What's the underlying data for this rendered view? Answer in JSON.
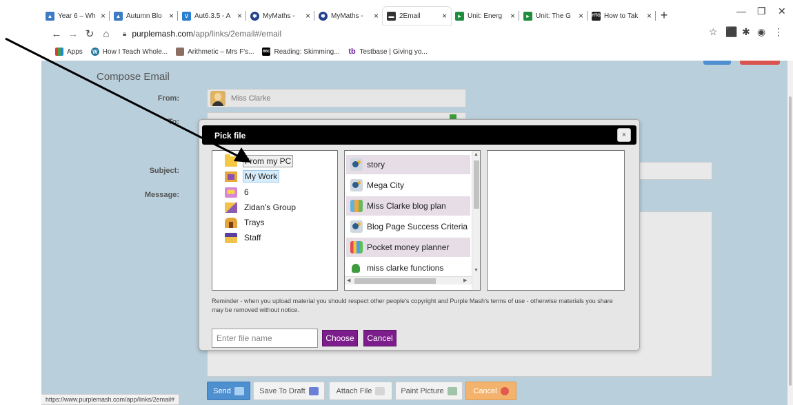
{
  "browser": {
    "tabs": [
      {
        "title": "Year 6 – Wh",
        "icon": "graduation-icon",
        "color": "#3b7cc4",
        "active": false
      },
      {
        "title": "Autumn Blo",
        "icon": "graduation-icon",
        "color": "#3b7cc4",
        "active": false
      },
      {
        "title": "Aut6.3.5 - A",
        "icon": "v-logo-icon",
        "color": "#2a7fd0",
        "active": false
      },
      {
        "title": "MyMaths -",
        "icon": "mymaths-icon",
        "color": "#1f3f8a",
        "active": false
      },
      {
        "title": "MyMaths -",
        "icon": "mymaths-icon",
        "color": "#1f3f8a",
        "active": false
      },
      {
        "title": "2Email",
        "icon": "email-icon",
        "color": "#333333",
        "active": true
      },
      {
        "title": "Unit: Energ",
        "icon": "unit-icon",
        "color": "#1e8e3e",
        "active": false
      },
      {
        "title": "Unit: The G",
        "icon": "unit-icon",
        "color": "#1e8e3e",
        "active": false
      },
      {
        "title": "How to Tak",
        "icon": "htg-icon",
        "color": "#222222",
        "active": false
      }
    ],
    "new_tab": "+",
    "url_host": "purplemash.com",
    "url_path": "/app/links/2email#/email",
    "bookmarks": [
      {
        "label": "Apps",
        "icon": "apps-grid-icon"
      },
      {
        "label": "How I Teach Whole...",
        "icon": "wordpress-icon"
      },
      {
        "label": "Arithmetic – Mrs F's...",
        "icon": "image-icon"
      },
      {
        "label": "Reading: Skimming...",
        "icon": "bbc-icon"
      },
      {
        "label": "Testbase | Giving yo...",
        "icon": "tb-icon"
      }
    ],
    "status_url": "https://www.purplemash.com/app/links/2email#"
  },
  "compose": {
    "title": "Compose Email",
    "from_label": "From:",
    "from_value": "Miss Clarke",
    "to_label": "To:",
    "subject_label": "Subject:",
    "message_label": "Message:",
    "buttons": {
      "send": "Send",
      "save_draft": "Save To Draft",
      "attach": "Attach File",
      "paint": "Paint Picture",
      "cancel": "Cancel"
    }
  },
  "dialog": {
    "title": "Pick file",
    "close": "×",
    "folders": [
      {
        "label": "From my PC",
        "icon": "folder-icon"
      },
      {
        "label": "My Work",
        "icon": "my-work-icon"
      },
      {
        "label": "6",
        "icon": "group-icon"
      },
      {
        "label": "Zidan's Group",
        "icon": "zidan-group-icon"
      },
      {
        "label": "Trays",
        "icon": "trays-icon"
      },
      {
        "label": "Staff",
        "icon": "staff-icon"
      }
    ],
    "files": [
      {
        "label": "story",
        "icon": "2write-icon"
      },
      {
        "label": "Mega City",
        "icon": "2write-icon"
      },
      {
        "label": "Miss Clarke blog plan",
        "icon": "blog-icon"
      },
      {
        "label": "Blog Page Success Criteria",
        "icon": "2write-icon"
      },
      {
        "label": "Pocket money planner",
        "icon": "spreadsheet-icon"
      },
      {
        "label": "miss clarke functions",
        "icon": "functions-icon"
      }
    ],
    "reminder": "Reminder - when you upload material you should respect other people's copyright and Purple Mash's terms of use - otherwise materials you share may be removed without notice.",
    "filename_placeholder": "Enter file name",
    "choose": "Choose",
    "cancel": "Cancel"
  },
  "colors": {
    "page_bg": "#b9cfdb",
    "dialog_button": "#7b1d8a",
    "send_button": "#4e8fd0",
    "cancel_button": "#f3b36d"
  }
}
